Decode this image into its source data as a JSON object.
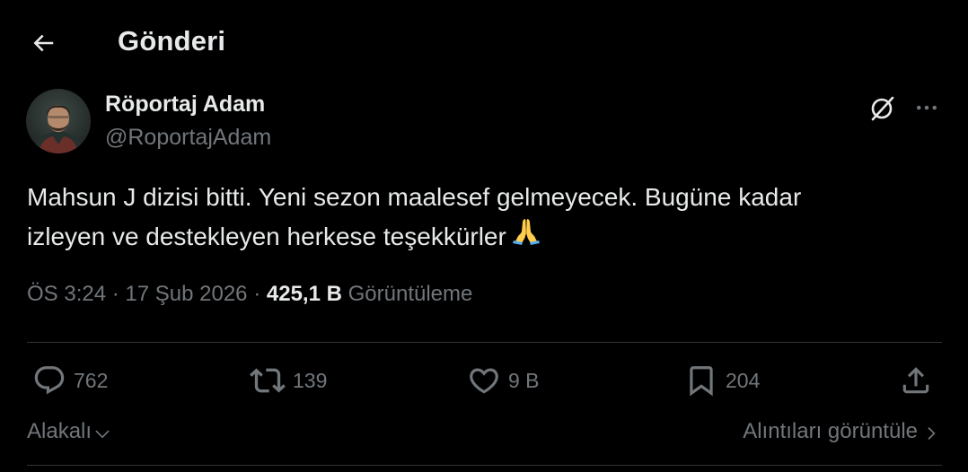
{
  "header": {
    "title": "Gönderi"
  },
  "author": {
    "display_name": "Röportaj Adam",
    "handle": "@RoportajAdam"
  },
  "tweet": {
    "line1": "Mahsun J dizisi bitti. Yeni sezon maalesef gelmeyecek. Bugüne kadar",
    "line2": "izleyen ve destekleyen herkese teşekkürler"
  },
  "meta": {
    "time": "ÖS 3:24",
    "sep1": "·",
    "date": "17 Şub 2026",
    "sep2": "·",
    "views_count": "425,1 B",
    "views_label": "Görüntüleme"
  },
  "actions": {
    "replies": "762",
    "reposts": "139",
    "likes": "9 B",
    "bookmarks": "204"
  },
  "footer": {
    "sort_label": "Alakalı",
    "quotes_label": "Alıntıları görüntüle"
  },
  "icons": {
    "back": "arrow-left-icon",
    "grok": "grok-icon",
    "more": "more-horizontal-icon",
    "reply": "reply-icon",
    "repost": "repost-icon",
    "like": "heart-icon",
    "bookmark": "bookmark-icon",
    "share": "share-icon",
    "emoji": "folded-hands-emoji"
  },
  "colors": {
    "background": "#000000",
    "text": "#e7e9ea",
    "secondary": "#71767b",
    "divider": "#2f3336"
  }
}
